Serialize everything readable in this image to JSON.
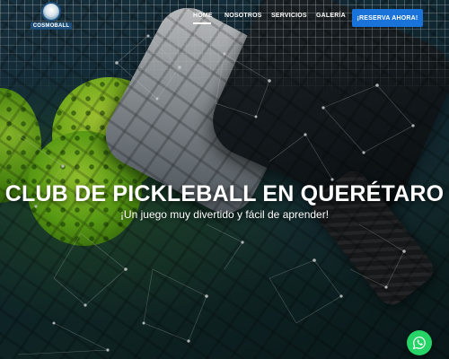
{
  "header": {
    "logo_text": "COSMOBALL",
    "nav": [
      {
        "label": "HOME",
        "active": true
      },
      {
        "label": "NOSOTROS"
      },
      {
        "label": "SERVICIOS"
      },
      {
        "label": "GALERÍA"
      }
    ],
    "cta_label": "¡RESERVA AHORA!"
  },
  "hero": {
    "title": "CLUB DE PICKLEBALL EN QUERÉTARO",
    "subtitle": "¡Un juego muy divertido y fácil de aprender!"
  },
  "floating": {
    "whatsapp_icon": "whatsapp-icon"
  },
  "colors": {
    "accent": "#1a73d9",
    "whatsapp": "#25d366",
    "ball": "#8bd11b"
  }
}
